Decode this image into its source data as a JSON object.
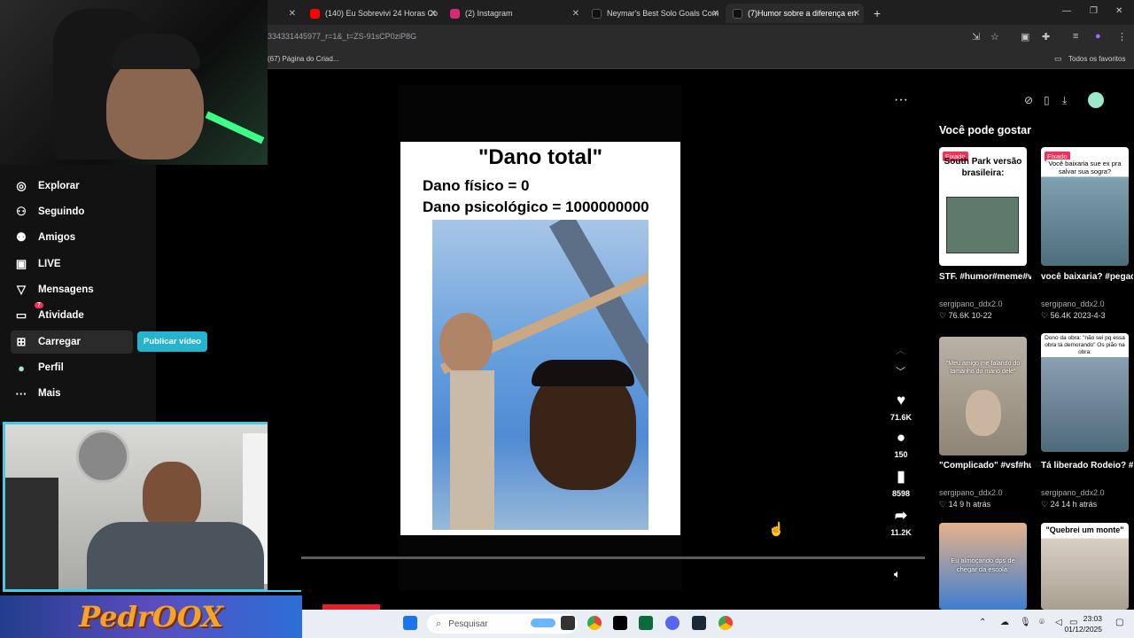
{
  "browser": {
    "tabs": [
      {
        "label": "(140) Eu Sobrevivi 24 Horas Co",
        "favicon_color": "#ff0000"
      },
      {
        "label": "(2) Instagram",
        "favicon_color": "#d62976"
      },
      {
        "label": "Neymar's Best Solo Goals Com",
        "favicon_color": "#111111"
      },
      {
        "label": "(7)Humor sobre a diferença en",
        "favicon_color": "#111111"
      }
    ],
    "url": "334331445977_r=1&_t=ZS-91sCP0ziP8G",
    "bookmark": "(67) Página do Criad...",
    "all_bookmarks": "Todos os favoritos"
  },
  "nav": {
    "items": [
      {
        "label": "Explorar",
        "icon": "compass-icon",
        "glyph": "◎"
      },
      {
        "label": "Seguindo",
        "icon": "person-icon",
        "glyph": "⚇"
      },
      {
        "label": "Amigos",
        "icon": "friends-icon",
        "glyph": "⚉"
      },
      {
        "label": "LIVE",
        "icon": "live-icon",
        "glyph": "▣"
      },
      {
        "label": "Mensagens",
        "icon": "send-icon",
        "glyph": "▽"
      },
      {
        "label": "Atividade",
        "icon": "inbox-icon",
        "glyph": "▭"
      },
      {
        "label": "Carregar",
        "icon": "upload-icon",
        "glyph": "⊞"
      },
      {
        "label": "Perfil",
        "icon": "avatar-icon",
        "glyph": "●"
      },
      {
        "label": "Mais",
        "icon": "more-icon",
        "glyph": "···"
      }
    ],
    "activity_badge": "7",
    "publish": "Publicar vídeo"
  },
  "video": {
    "title": "\"Dano total\"",
    "line1": "Dano físico = 0",
    "line2": "Dano psicológico = 1000000000",
    "likes": "71.6K",
    "comments": "150",
    "saves": "8598",
    "shares": "11.2K",
    "progress": 0.0
  },
  "sidebar": {
    "heading": "Você pode gostar",
    "cards": [
      {
        "pin": "Fixado",
        "overlay": "South Park versão brasileira:",
        "title": "STF. #humor#meme#vir...",
        "author": "sergipano_ddx2.0",
        "likes": "76.6K",
        "date": "10-22"
      },
      {
        "pin": "Fixado",
        "overlay": "Você baixaria sue ex pra salvar sua sogra?",
        "title": "você baixaria? #pegadinha #foryo...",
        "author": "sergipano_ddx2.0",
        "likes": "56.4K",
        "date": "2023-4-3"
      },
      {
        "pin": "",
        "overlay": "\"Meu amigo me falando do tamanho do mano dele\"",
        "title": "\"Complicado\" #vsf#humor#mem...",
        "author": "sergipano_ddx2.0",
        "likes": "14",
        "date": "9 h atrás"
      },
      {
        "pin": "",
        "overlay": "Dono da obra: \"não sei pq essa obra tá demorando\" Os pião na obra:",
        "title": "Tá liberado Rodeio? #viral#meme#hum...",
        "author": "sergipano_ddx2.0",
        "likes": "24",
        "date": "14 h atrás"
      },
      {
        "pin": "",
        "overlay": "Eu almoçando dps de chegar da escola:",
        "title": "",
        "author": "",
        "likes": "",
        "date": ""
      },
      {
        "pin": "",
        "overlay": "\"Quebrei um monte\"",
        "title": "",
        "author": "",
        "likes": "",
        "date": ""
      }
    ]
  },
  "stream": {
    "logo": "PedrOOX"
  },
  "taskbar": {
    "search_placeholder": "Pesquisar",
    "time": "23:03",
    "date": "01/12/2025"
  }
}
